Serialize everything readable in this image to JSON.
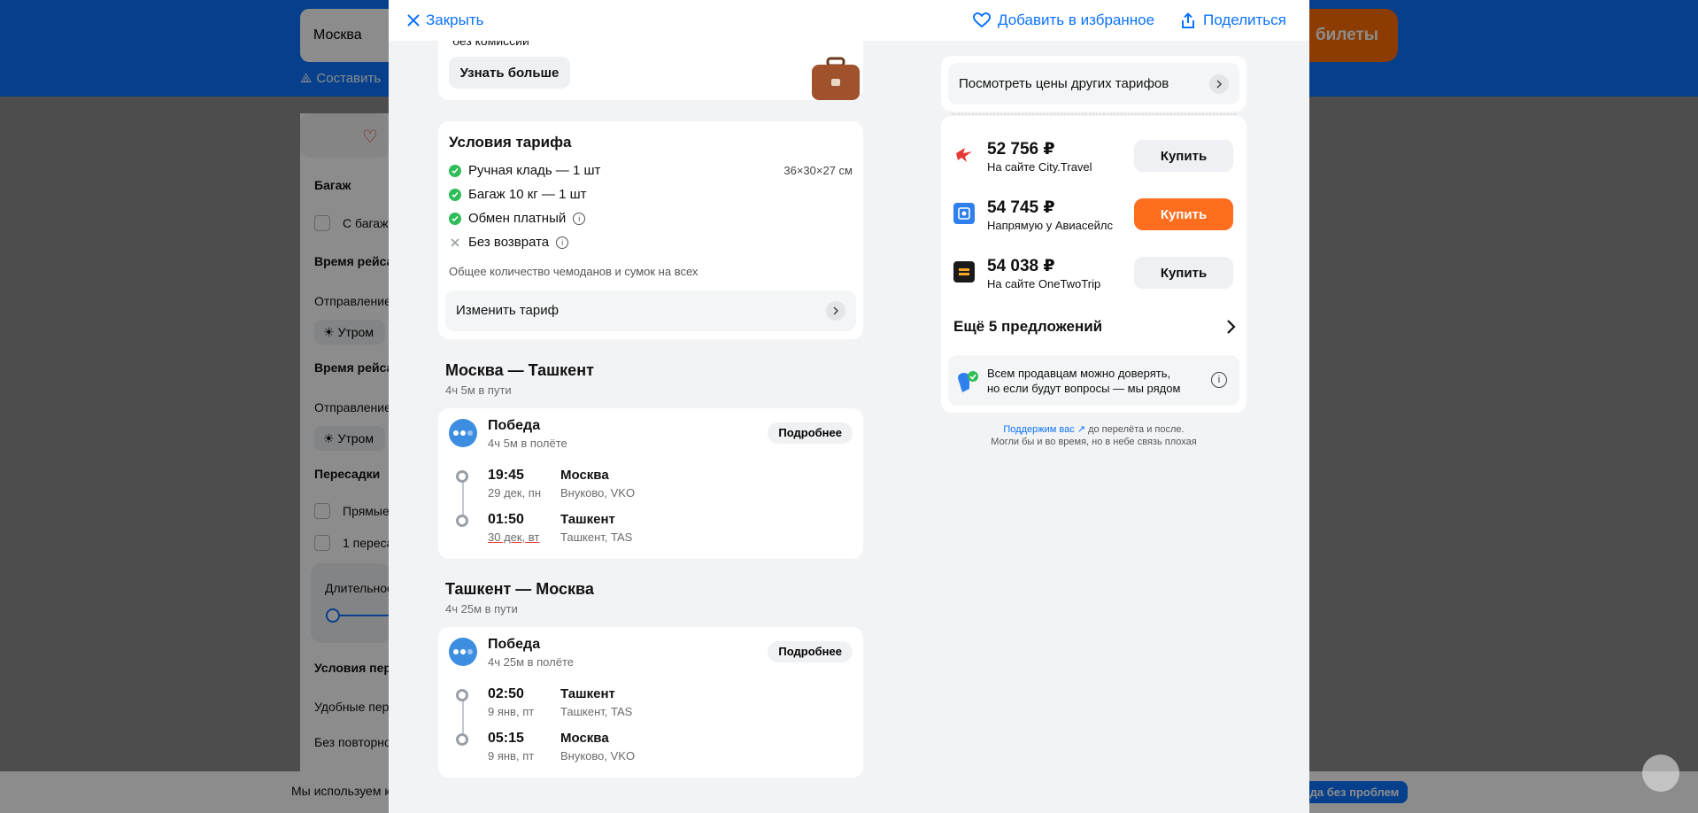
{
  "background": {
    "search_value": "Москва",
    "compose_label": "Составить",
    "tickets_label": "билеты",
    "filters": {
      "baggage_title": "Багаж",
      "baggage_option": "С багажо",
      "time1_title": "Время рейса",
      "time1_departure": "Отправление",
      "time1_pill": "Утром",
      "time2_title": "Время рейса",
      "time2_departure": "Отправление",
      "time2_pill": "Утром",
      "transfers_title": "Пересадки",
      "transfer_direct": "Прямые",
      "transfer_one": "1 пересад",
      "duration_label": "Длительнос",
      "conditions_title": "Условия пере",
      "convenient": "Удобные пере",
      "no_repeat": "Без повторно"
    },
    "cookie_text": "Мы используем ку",
    "cookie_button": "да без проблем"
  },
  "modal": {
    "close_label": "Закрыть",
    "favorite_label": "Добавить в избранное",
    "share_label": "Поделиться",
    "promo": {
      "cut_text": "без комиссии",
      "learn_more": "Узнать больше"
    },
    "tariff": {
      "title": "Условия тарифа",
      "items": [
        {
          "label": "Ручная кладь — 1 шт",
          "extra": "36×30×27 см",
          "ok": true
        },
        {
          "label": "Багаж 10 кг — 1 шт",
          "extra": "",
          "ok": true
        },
        {
          "label": "Обмен платный",
          "extra": "",
          "ok": true
        },
        {
          "label": "Без возврата",
          "extra": "",
          "ok": false
        }
      ],
      "note": "Общее количество чемоданов и сумок на всех",
      "change_label": "Изменить тариф"
    },
    "segments": [
      {
        "title": "Москва — Ташкент",
        "duration": "4ч 5м в пути",
        "airline": "Победа",
        "flight_time": "4ч 5м в полёте",
        "details": "Подробнее",
        "dep_time": "19:45",
        "dep_date": "29 дек, пн",
        "dep_city": "Москва",
        "dep_airport": "Внуково, VKO",
        "arr_time": "01:50",
        "arr_date": "30 дек, вт",
        "arr_city": "Ташкент",
        "arr_airport": "Ташкент, TAS"
      },
      {
        "title": "Ташкент — Москва",
        "duration": "4ч 25м в пути",
        "airline": "Победа",
        "flight_time": "4ч 25м в полёте",
        "details": "Подробнее",
        "dep_time": "02:50",
        "dep_date": "9 янв, пт",
        "dep_city": "Ташкент",
        "dep_airport": "Ташкент, TAS",
        "arr_time": "05:15",
        "arr_date": "9 янв, пт",
        "arr_city": "Москва",
        "arr_airport": "Внуково, VKO"
      }
    ],
    "other_tariffs": "Посмотреть цены других тарифов",
    "offers": [
      {
        "price": "52 756 ₽",
        "seller": "На сайте City.Travel",
        "buy": "Купить",
        "color": "#e53935"
      },
      {
        "price": "54 745 ₽",
        "seller": "Напрямую у Авиасейлс",
        "buy": "Купить",
        "color": "#2f80ed"
      },
      {
        "price": "54 038 ₽",
        "seller": "На сайте OneTwoTrip",
        "buy": "Купить",
        "color": "#1a1a1a"
      }
    ],
    "more_offers": "Ещё 5 предложений",
    "trust_line1": "Всем продавцам можно доверять,",
    "trust_line2": "но если будут вопросы — мы рядом",
    "support_link": "Поддержим вас",
    "support_text1": "до перелёта и после.",
    "support_text2": "Могли бы и во время, но в небе связь плохая"
  },
  "colors": {
    "accent": "#0c73fe",
    "buy_orange": "#ff6d1f",
    "ok_green": "#2ebd59"
  }
}
